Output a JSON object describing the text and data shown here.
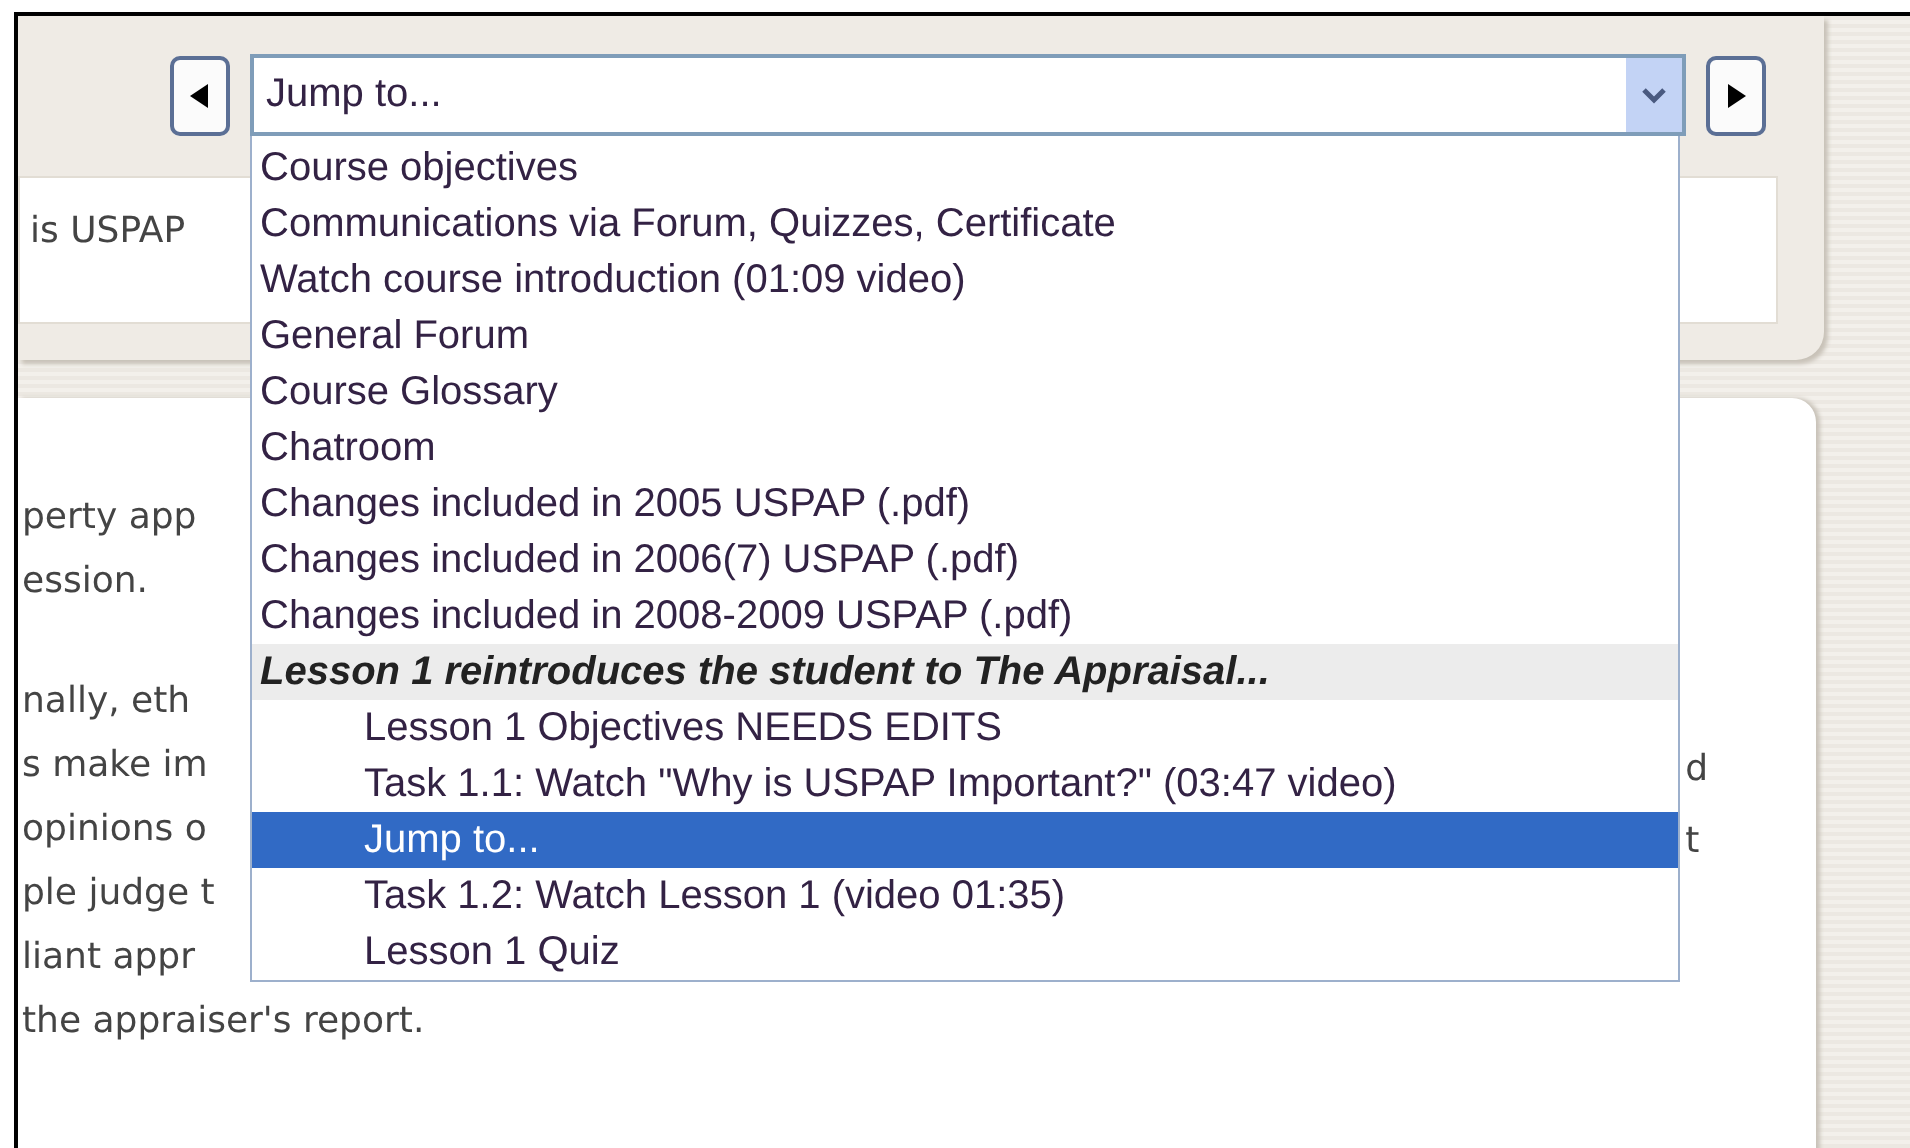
{
  "jump_menu": {
    "value": "Jump to...",
    "expanded": true,
    "options": [
      {
        "label": "Course objectives",
        "kind": "option",
        "selected": false
      },
      {
        "label": "Communications via Forum, Quizzes, Certificate",
        "kind": "option",
        "selected": false
      },
      {
        "label": "Watch course introduction (01:09 video)",
        "kind": "option",
        "selected": false
      },
      {
        "label": "General Forum",
        "kind": "option",
        "selected": false
      },
      {
        "label": "Course Glossary",
        "kind": "option",
        "selected": false
      },
      {
        "label": "Chatroom",
        "kind": "option",
        "selected": false
      },
      {
        "label": "Changes included in 2005 USPAP (.pdf)",
        "kind": "option",
        "selected": false
      },
      {
        "label": "Changes included in 2006(7) USPAP (.pdf)",
        "kind": "option",
        "selected": false
      },
      {
        "label": "Changes included in 2008-2009 USPAP (.pdf)",
        "kind": "option",
        "selected": false
      },
      {
        "label": "Lesson 1 reintroduces the student to The Appraisal...",
        "kind": "group",
        "children": [
          {
            "label": "Lesson 1 Objectives NEEDS EDITS",
            "kind": "option",
            "selected": false
          },
          {
            "label": "Task 1.1: Watch \"Why is USPAP Important?\" (03:47 video)",
            "kind": "option",
            "selected": false
          },
          {
            "label": "Jump to...",
            "kind": "option",
            "selected": true
          },
          {
            "label": "Task 1.2: Watch Lesson 1 (video 01:35)",
            "kind": "option",
            "selected": false
          },
          {
            "label": "Lesson 1 Quiz",
            "kind": "option",
            "selected": false
          }
        ]
      }
    ]
  },
  "summary_text": "is USPAP",
  "body_paragraphs": [
    [
      "perty app",
      "ession."
    ],
    [
      "nally, eth",
      "s make im",
      "opinions o",
      "ple judge t",
      "liant appr",
      "the appraiser's report."
    ]
  ],
  "right_fragments": [
    "d",
    "t"
  ]
}
